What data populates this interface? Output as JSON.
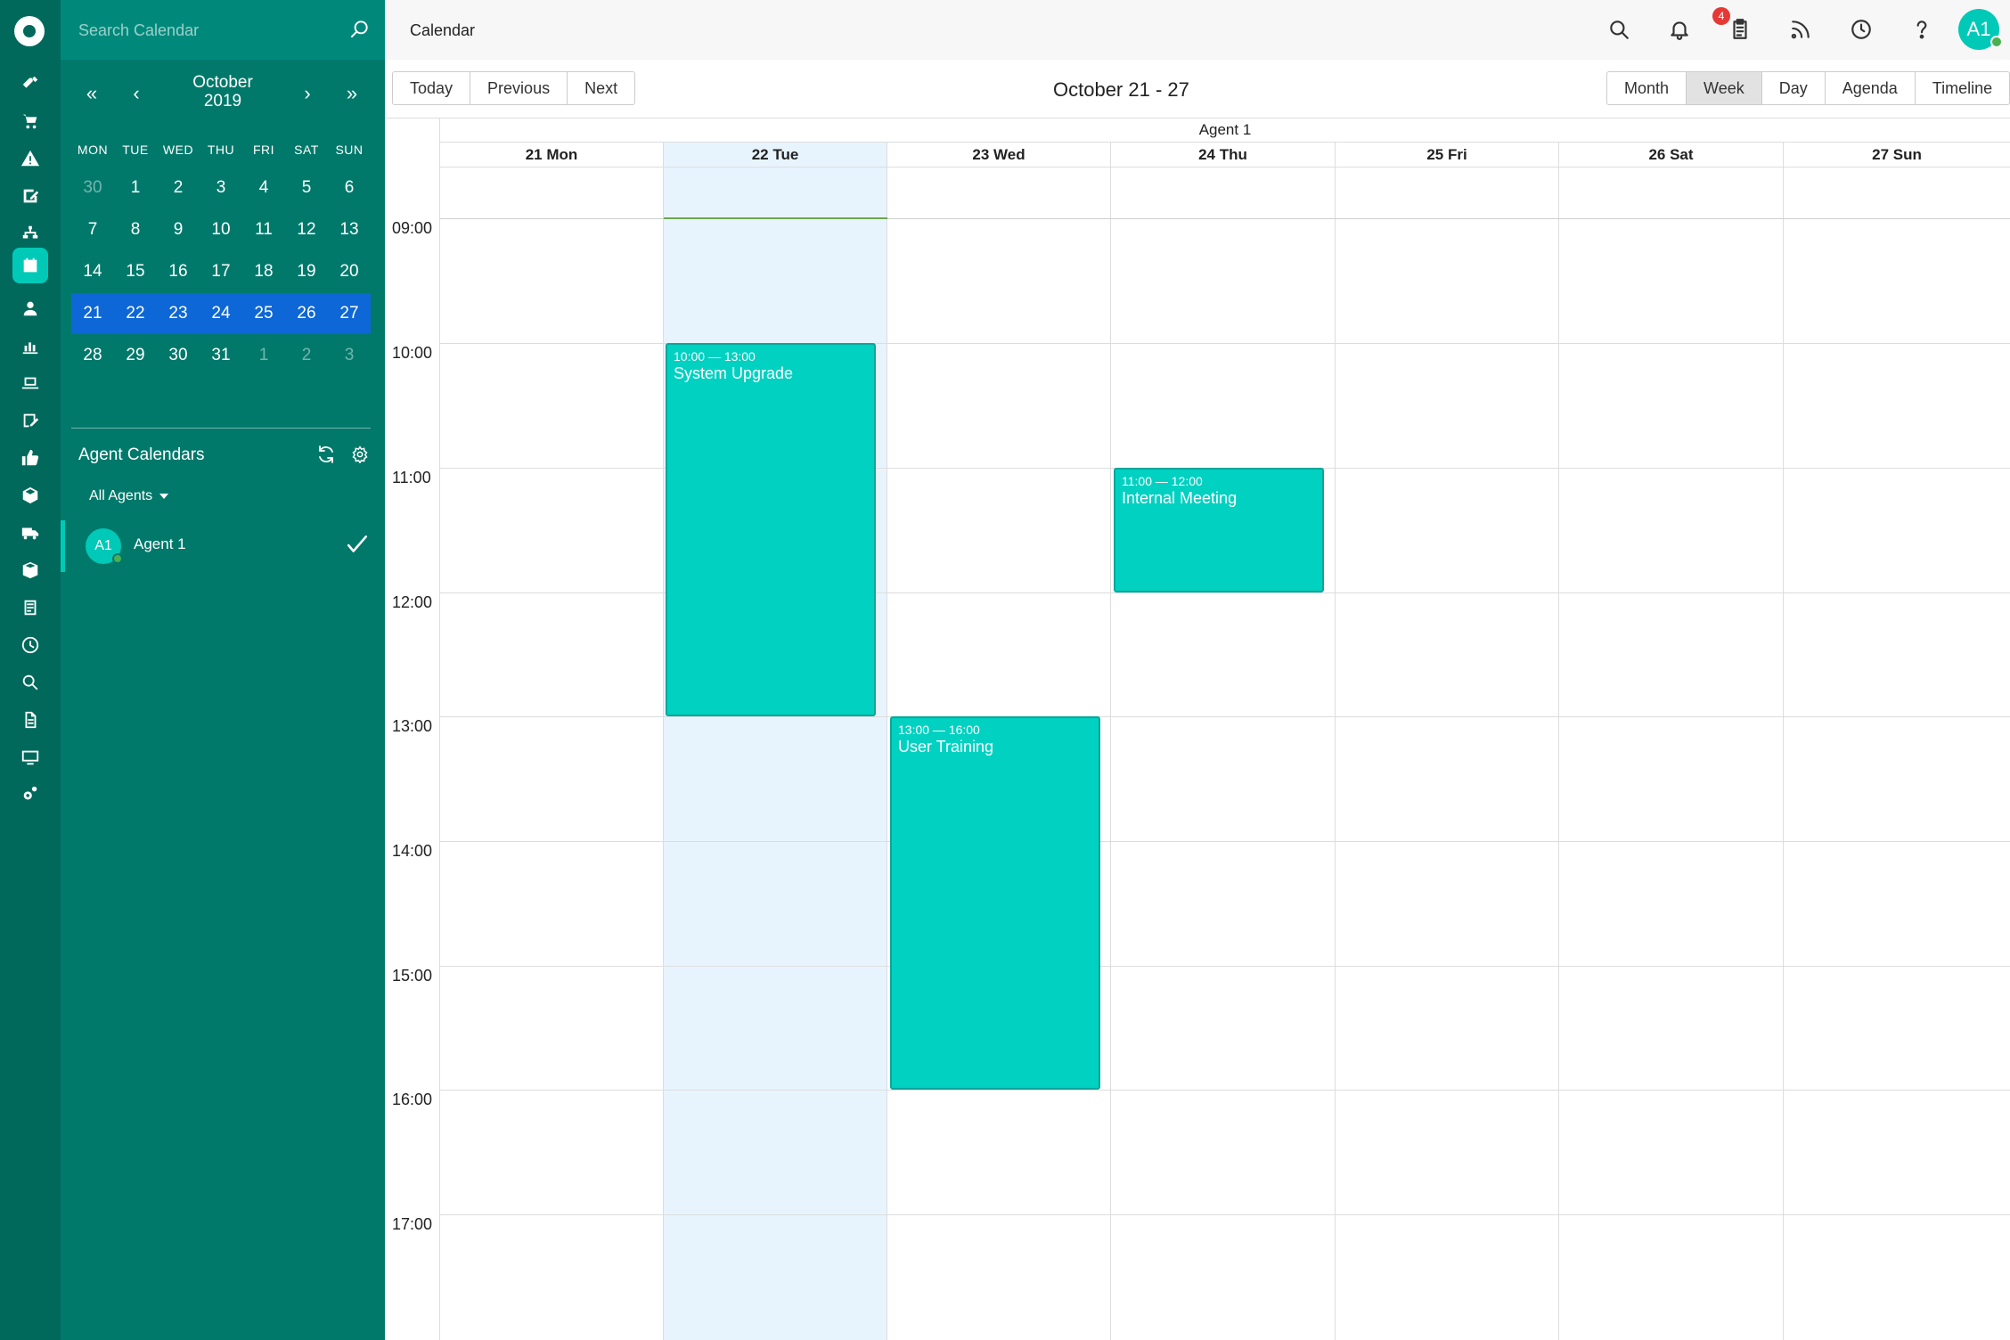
{
  "rail": {
    "items": [
      "tickets",
      "shop",
      "alerts",
      "edit",
      "org",
      "calendar",
      "user",
      "reports",
      "devices",
      "notes",
      "feedback",
      "assets",
      "delivery",
      "packages",
      "documents",
      "time",
      "search",
      "files",
      "monitor",
      "settings"
    ]
  },
  "search": {
    "placeholder": "Search Calendar",
    "value": ""
  },
  "mini_calendar": {
    "nav": {
      "first": "«",
      "prev": "‹",
      "next": "›",
      "last": "»"
    },
    "month": "October",
    "year": "2019",
    "weekdays": [
      "MON",
      "TUE",
      "WED",
      "THU",
      "FRI",
      "SAT",
      "SUN"
    ],
    "weeks": [
      [
        "30",
        "1",
        "2",
        "3",
        "4",
        "5",
        "6"
      ],
      [
        "7",
        "8",
        "9",
        "10",
        "11",
        "12",
        "13"
      ],
      [
        "14",
        "15",
        "16",
        "17",
        "18",
        "19",
        "20"
      ],
      [
        "21",
        "22",
        "23",
        "24",
        "25",
        "26",
        "27"
      ],
      [
        "28",
        "29",
        "30",
        "31",
        "1",
        "2",
        "3"
      ]
    ]
  },
  "agent_calendars": {
    "title": "Agent Calendars",
    "filter": "All Agents",
    "agents": [
      {
        "initials": "A1",
        "name": "Agent 1",
        "checked": "✓"
      }
    ]
  },
  "topbar": {
    "title": "Calendar",
    "notification_count": "4",
    "user_initials": "A1"
  },
  "toolbar": {
    "nav_buttons": [
      "Today",
      "Previous",
      "Next"
    ],
    "range_label": "October 21 - 27",
    "views": [
      "Month",
      "Week",
      "Day",
      "Agenda",
      "Timeline"
    ],
    "active_view": "Week"
  },
  "grid": {
    "resource": "Agent 1",
    "days": [
      "21 Mon",
      "22 Tue",
      "23 Wed",
      "24 Thu",
      "25 Fri",
      "26 Sat",
      "27 Sun"
    ],
    "hours": [
      "09:00",
      "10:00",
      "11:00",
      "12:00",
      "13:00",
      "14:00",
      "15:00",
      "16:00",
      "17:00"
    ]
  },
  "events": [
    {
      "time": "10:00 — 13:00",
      "title": "System Upgrade"
    },
    {
      "time": "11:00 — 12:00",
      "title": "Internal Meeting"
    },
    {
      "time": "13:00 — 16:00",
      "title": "User Training"
    }
  ],
  "colors": {
    "rail": "#00695c",
    "panel": "#00796b",
    "accent": "#00c9b7",
    "event": "#00d1c1",
    "selected_week": "#0d67d6",
    "today_column": "#e8f4fd",
    "badge": "#e53935"
  }
}
